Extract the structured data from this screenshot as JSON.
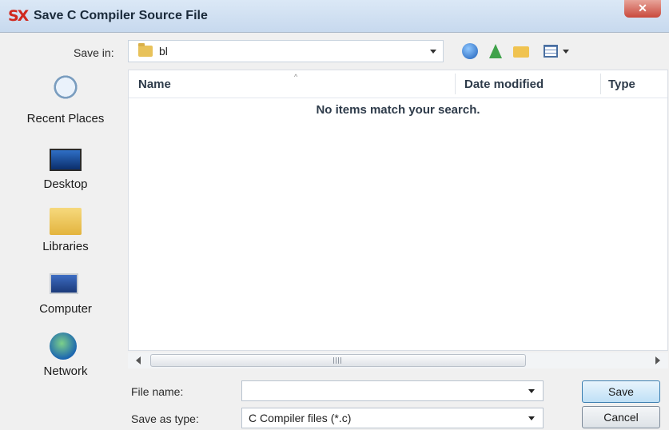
{
  "window": {
    "title": "Save C Compiler Source File",
    "app_icon": "SX",
    "close_glyph": "✕"
  },
  "save_in": {
    "label": "Save in:",
    "value": "bl"
  },
  "toolbar": {
    "icons": [
      "back-icon",
      "up-folder-icon",
      "new-folder-icon",
      "view-menu-icon"
    ]
  },
  "places": [
    {
      "label": "Recent Places",
      "icon": "recent-places-icon"
    },
    {
      "label": "Desktop",
      "icon": "desktop-icon"
    },
    {
      "label": "Libraries",
      "icon": "libraries-icon"
    },
    {
      "label": "Computer",
      "icon": "computer-icon"
    },
    {
      "label": "Network",
      "icon": "network-icon"
    }
  ],
  "file_list": {
    "columns": [
      "Name",
      "Date modified",
      "Type"
    ],
    "empty_message": "No items match your search."
  },
  "file_name": {
    "label": "File name:",
    "value": ""
  },
  "save_as_type": {
    "label": "Save as type:",
    "value": "C Compiler files (*.c)"
  },
  "buttons": {
    "save": "Save",
    "cancel": "Cancel"
  }
}
